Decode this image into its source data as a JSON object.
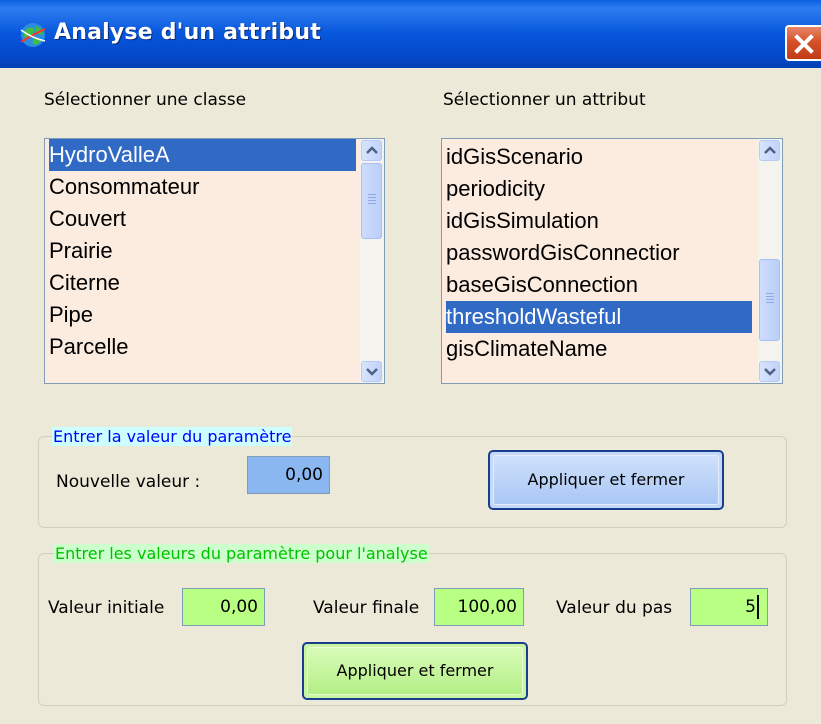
{
  "window": {
    "title": "Analyse d'un attribut",
    "icon": "globe-app-icon",
    "close_icon": "close-icon"
  },
  "class_panel": {
    "label": "Sélectionner une classe",
    "items": [
      "HydroValleA",
      "Consommateur",
      "Couvert",
      "Prairie",
      "Citerne",
      "Pipe",
      "Parcelle"
    ],
    "selected": "HydroValleA"
  },
  "attribute_panel": {
    "label": "Sélectionner un attribut",
    "items": [
      "idGisScenario",
      "periodicity",
      "idGisSimulation",
      "passwordGisConnectior",
      "baseGisConnection",
      "thresholdWasteful",
      "gisClimateName"
    ],
    "selected": "thresholdWasteful"
  },
  "param_group": {
    "legend": "Entrer la valeur du paramètre",
    "new_value_label": "Nouvelle valeur :",
    "new_value": "0,00",
    "apply_label": "Appliquer et fermer"
  },
  "analysis_group": {
    "legend": "Entrer les valeurs du paramètre pour l'analyse",
    "initial_label": "Valeur initiale",
    "initial_value": "0,00",
    "final_label": "Valeur finale",
    "final_value": "100,00",
    "step_label": "Valeur du pas",
    "step_value": "5",
    "apply_label": "Appliquer et fermer"
  },
  "colors": {
    "titlebar": "#0656dc",
    "selection": "#316ac5",
    "list_bg": "#fcece0",
    "blue_field": "#8bb7f0",
    "green_field": "#b9ff84",
    "legend1_bg": "#ccffff",
    "legend1_text": "#0000ff",
    "legend2_bg": "#ccffcc",
    "legend2_text": "#00c000"
  }
}
